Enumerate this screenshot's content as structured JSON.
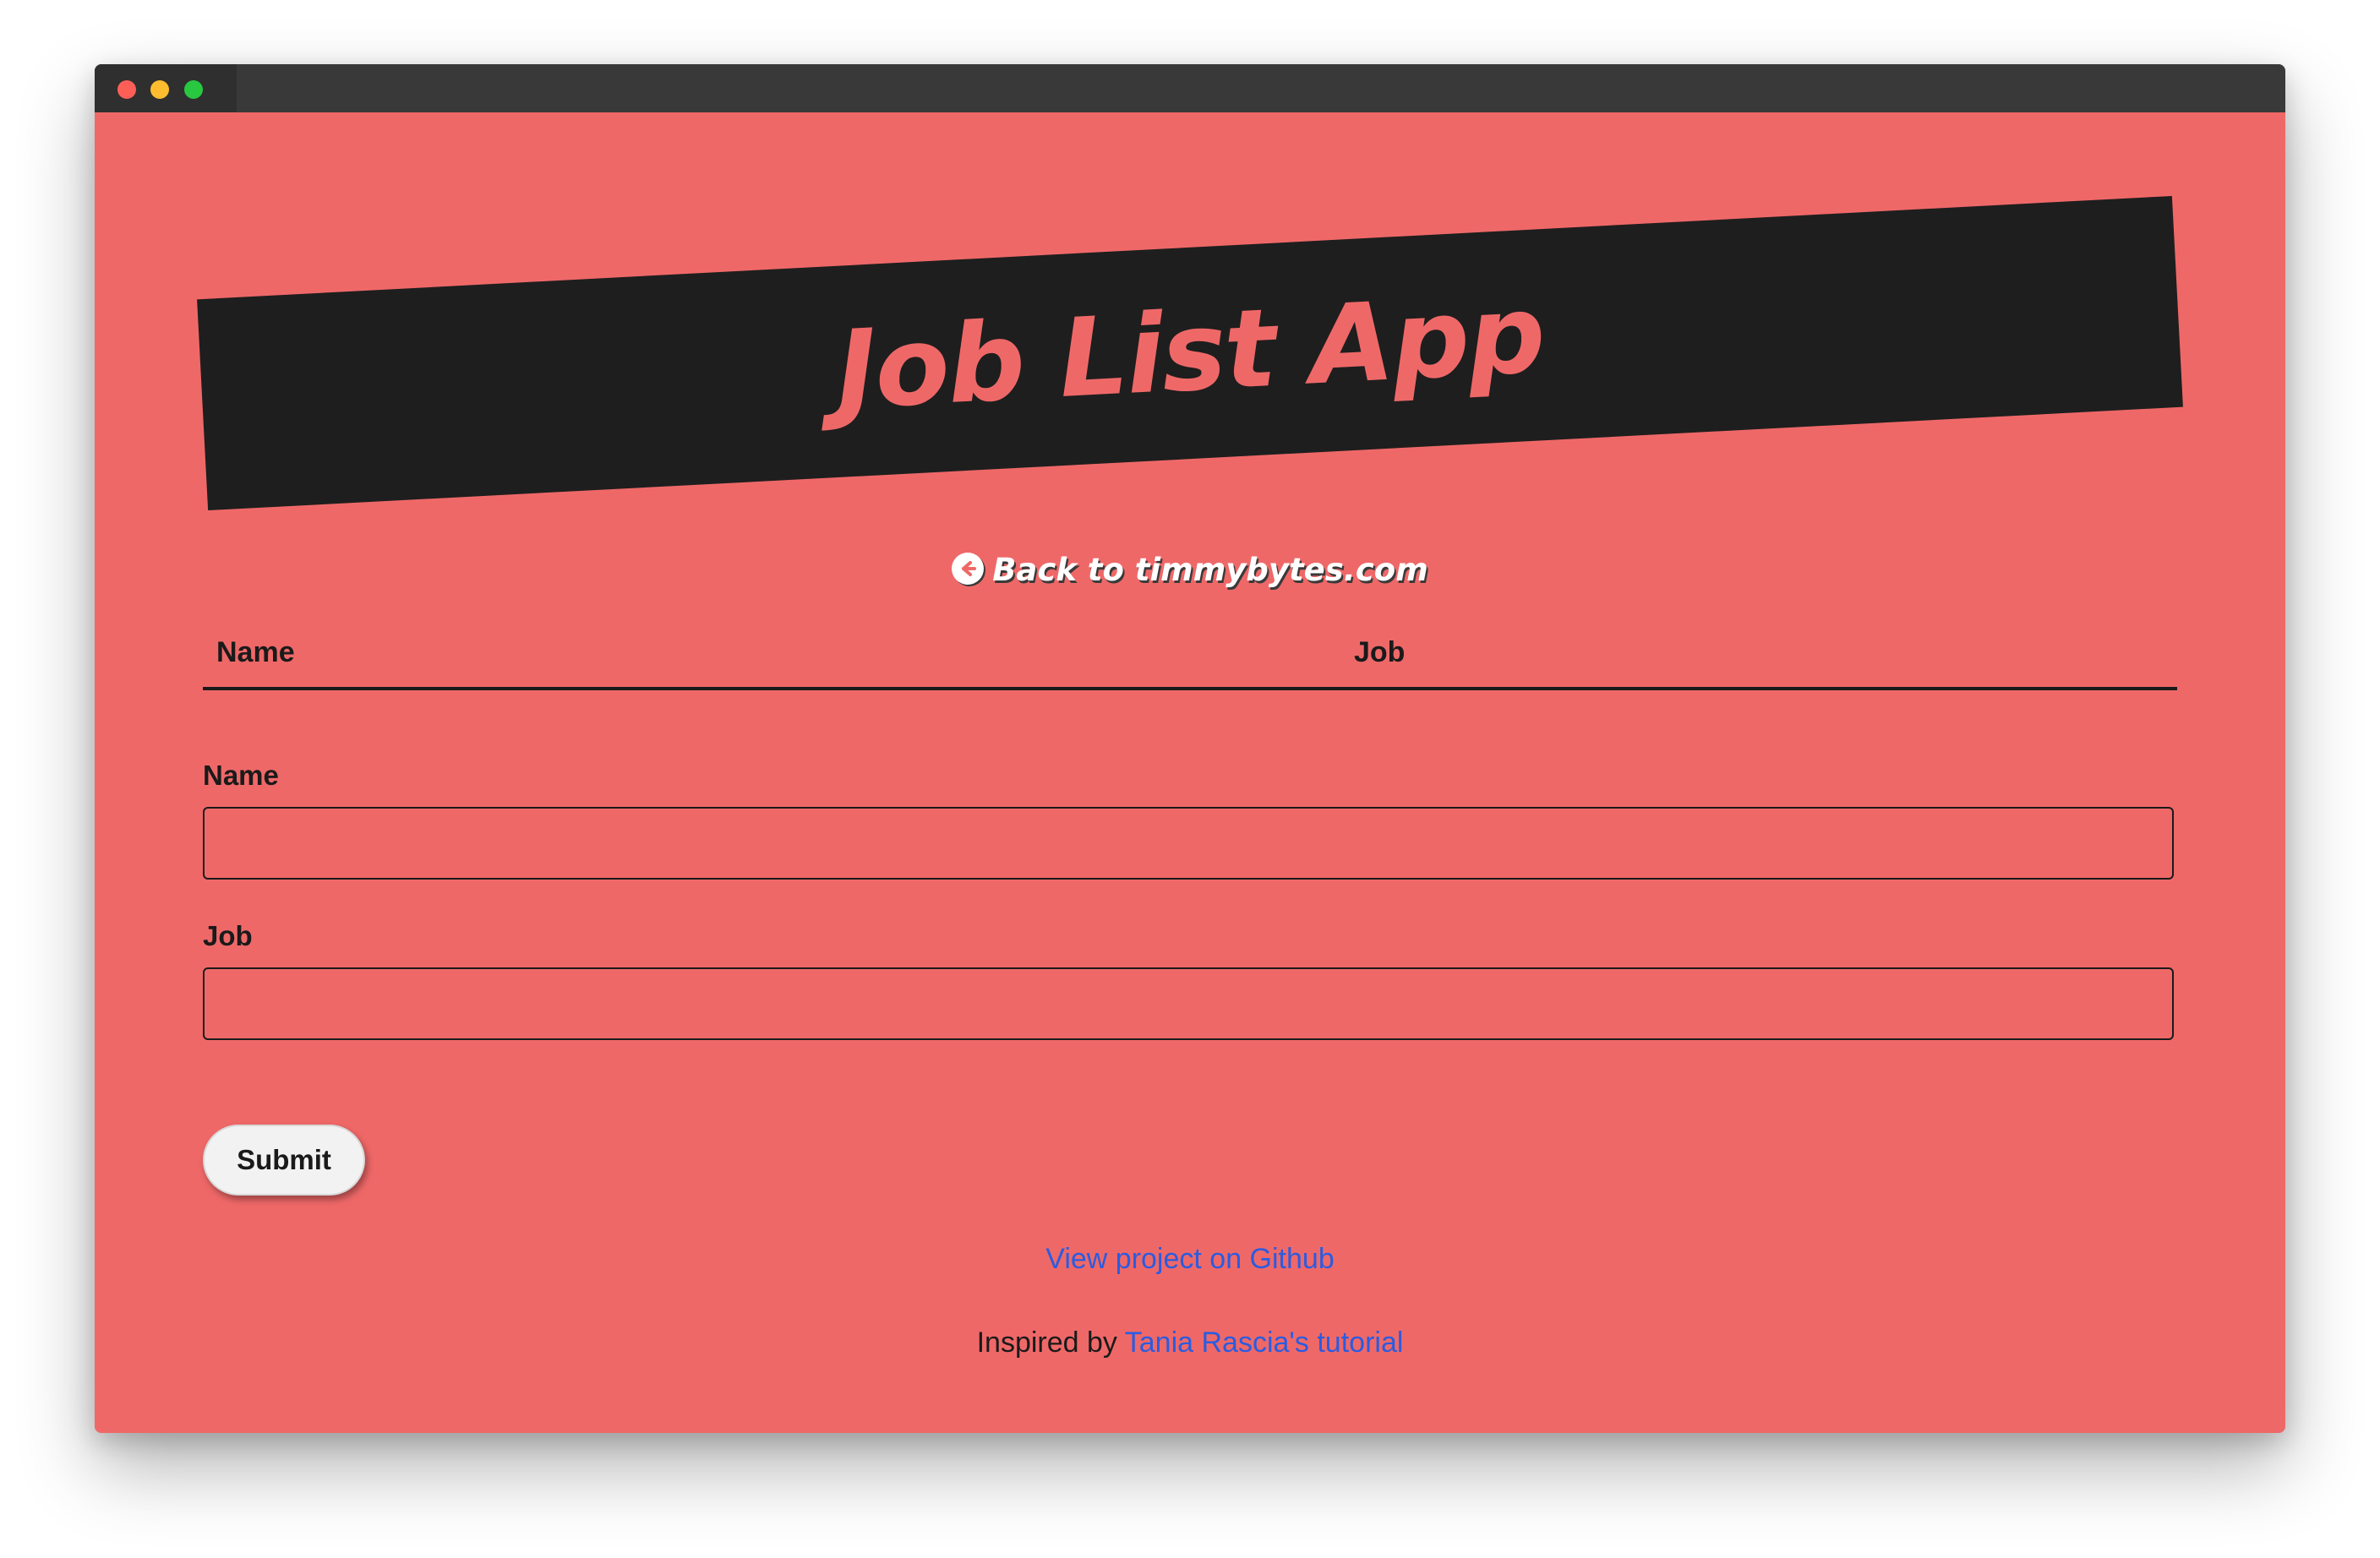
{
  "colors": {
    "page_background": "#ef6868",
    "banner_background": "#1e1e1e",
    "title_color": "#ef6868",
    "link_color": "#2a5ce0",
    "traffic_red": "#fd5f57",
    "traffic_yellow": "#fdbd2e",
    "traffic_green": "#28c840"
  },
  "window": {
    "traffic_lights": [
      "close",
      "minimize",
      "zoom"
    ]
  },
  "header": {
    "title": "Job List App"
  },
  "back_link": {
    "icon": "arrow-left-circle-icon",
    "label": "Back to timmybytes.com"
  },
  "table": {
    "columns": [
      "Name",
      "Job"
    ],
    "rows": []
  },
  "form": {
    "name_label": "Name",
    "name_value": "",
    "job_label": "Job",
    "job_value": "",
    "submit_label": "Submit"
  },
  "footer": {
    "github_link": "View project on Github",
    "inspired_prefix": "Inspired by",
    "inspired_link": "Tania Rascia's tutorial"
  }
}
